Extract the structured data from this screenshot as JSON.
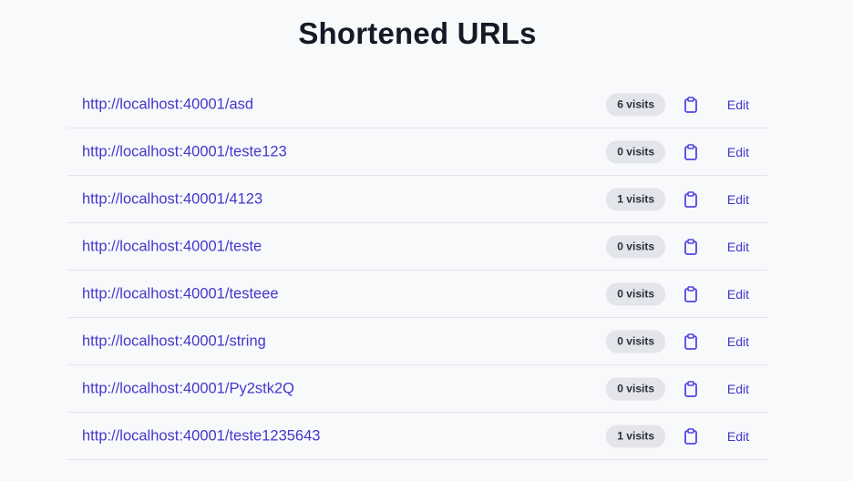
{
  "page": {
    "title": "Shortened URLs"
  },
  "colors": {
    "background": "#f8f9fb",
    "link": "#4338ca",
    "badge_bg": "#e3e5ea",
    "divider": "#e3e5ea"
  },
  "icons": {
    "copy": "clipboard-icon"
  },
  "urls": [
    {
      "url": "http://localhost:40001/asd",
      "visits": "6 visits",
      "edit": "Edit"
    },
    {
      "url": "http://localhost:40001/teste123",
      "visits": "0 visits",
      "edit": "Edit"
    },
    {
      "url": "http://localhost:40001/4123",
      "visits": "1 visits",
      "edit": "Edit"
    },
    {
      "url": "http://localhost:40001/teste",
      "visits": "0 visits",
      "edit": "Edit"
    },
    {
      "url": "http://localhost:40001/testeee",
      "visits": "0 visits",
      "edit": "Edit"
    },
    {
      "url": "http://localhost:40001/string",
      "visits": "0 visits",
      "edit": "Edit"
    },
    {
      "url": "http://localhost:40001/Py2stk2Q",
      "visits": "0 visits",
      "edit": "Edit"
    },
    {
      "url": "http://localhost:40001/teste1235643",
      "visits": "1 visits",
      "edit": "Edit"
    }
  ]
}
